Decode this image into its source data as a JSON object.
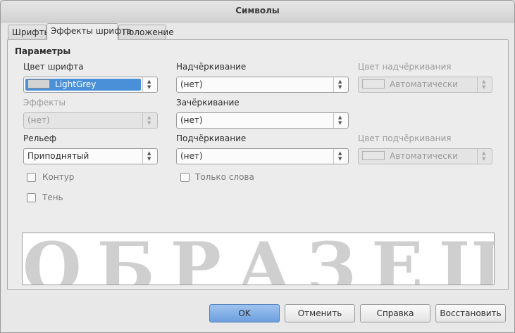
{
  "window": {
    "title": "Символы"
  },
  "tabs": [
    {
      "label": "Шрифты",
      "active": false
    },
    {
      "label": "Эффекты шрифта",
      "active": true
    },
    {
      "label": "Положение",
      "active": false
    }
  ],
  "parameters": {
    "heading": "Параметры",
    "font_color": {
      "label": "Цвет шрифта",
      "value": "LightGrey",
      "swatch_color": "#d3d3d3"
    },
    "effects": {
      "label": "Эффекты",
      "value": "(нет)",
      "disabled": true
    },
    "relief": {
      "label": "Рельеф",
      "value": "Приподнятый"
    },
    "contour": {
      "label": "Контур",
      "checked": false
    },
    "shadow": {
      "label": "Тень",
      "checked": false
    },
    "overline": {
      "label": "Надчёркивание",
      "value": "(нет)"
    },
    "strikethrough": {
      "label": "Зачёркивание",
      "value": "(нет)"
    },
    "underline": {
      "label": "Подчёркивание",
      "value": "(нет)"
    },
    "words_only": {
      "label": "Только слова",
      "checked": false
    },
    "overline_color": {
      "label": "Цвет надчёркивания",
      "value": "Автоматически",
      "disabled": true
    },
    "underline_color": {
      "label": "Цвет подчёркивания",
      "value": "Автоматически",
      "disabled": true
    }
  },
  "preview": {
    "text": "ОБРАЗЕЦ",
    "text_color": "#d3d3d3"
  },
  "buttons": {
    "ok": "OK",
    "cancel": "Отменить",
    "help": "Справка",
    "reset": "Восстановить"
  },
  "icons": {
    "spin": "spin-up-down-icon",
    "checkbox": "checkbox-icon"
  },
  "colors": {
    "accent": "#4a90d9",
    "primary_button": "#7aa8e2"
  }
}
